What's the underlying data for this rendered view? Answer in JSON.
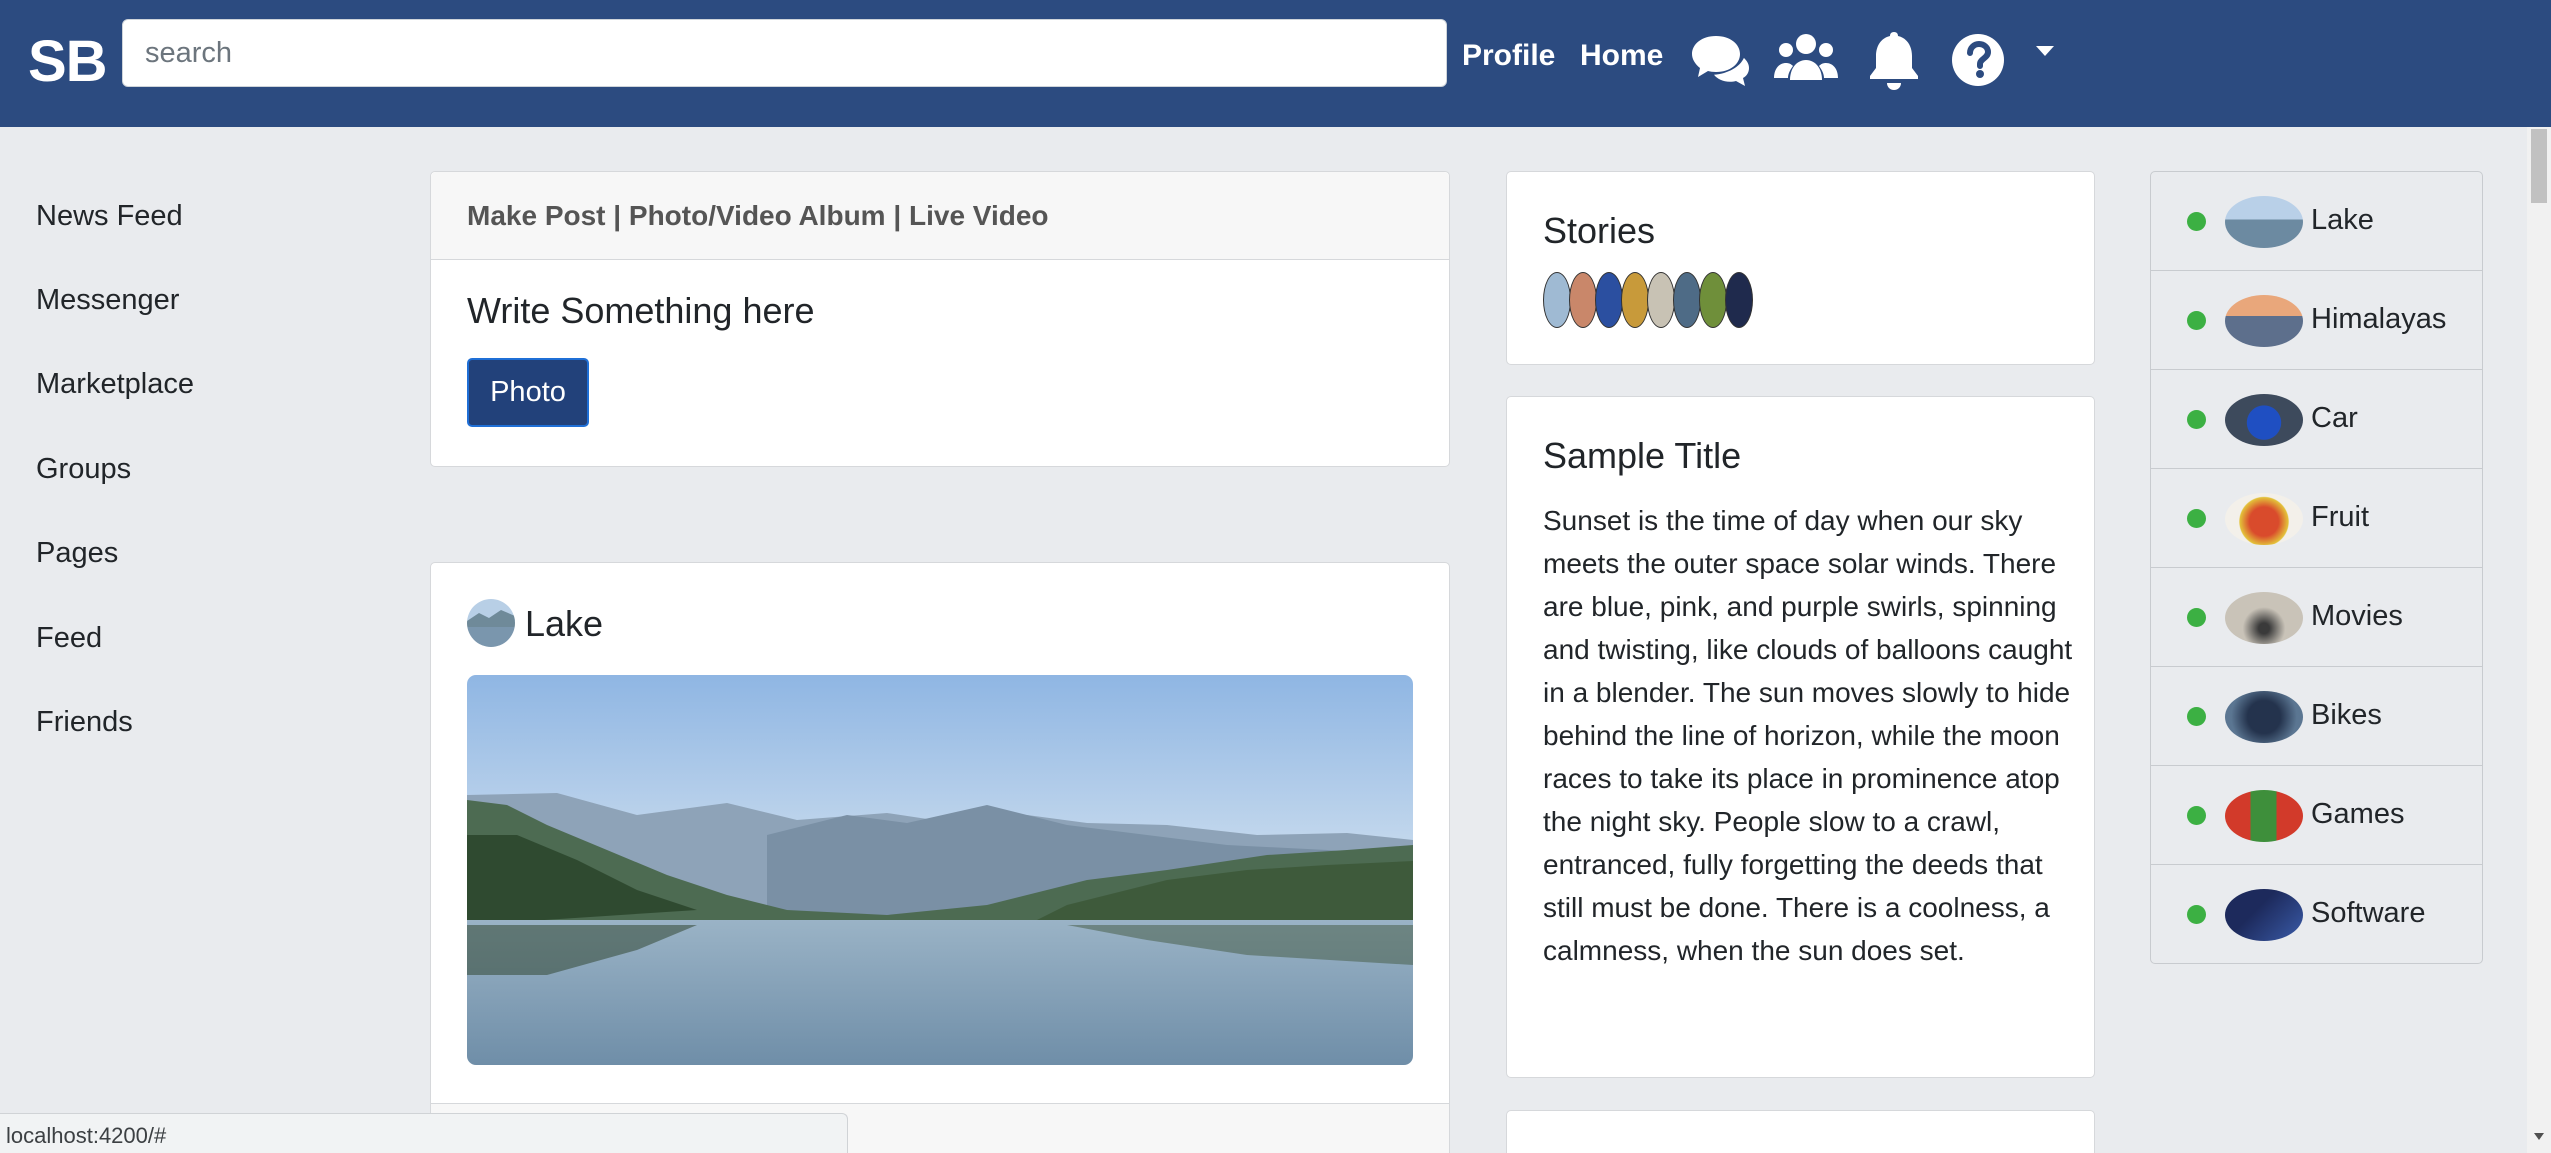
{
  "navbar": {
    "brand": "SB",
    "search_placeholder": "search",
    "links": {
      "profile": "Profile",
      "home": "Home"
    },
    "icons": [
      "chat-icon",
      "group-icon",
      "bell-icon",
      "help-icon",
      "caret-down-icon"
    ],
    "colors": {
      "background": "#2c4b80",
      "text": "#ffffff"
    }
  },
  "sidebar": {
    "items": [
      {
        "label": "News Feed"
      },
      {
        "label": "Messenger"
      },
      {
        "label": "Marketplace"
      },
      {
        "label": "Groups"
      },
      {
        "label": "Pages"
      },
      {
        "label": "Feed"
      },
      {
        "label": "Friends"
      }
    ]
  },
  "composer": {
    "links": [
      "Make Post",
      "Photo/Video Album",
      "Live Video"
    ],
    "separator": " | ",
    "title": "Write Something here",
    "photo_button": "Photo"
  },
  "post": {
    "author": "Lake",
    "image": "lake-landscape"
  },
  "stories": {
    "title": "Stories",
    "thumbnails": [
      "lake",
      "himalayas",
      "car",
      "fruit",
      "movies",
      "bikes",
      "games",
      "software"
    ]
  },
  "sample_card": {
    "title": "Sample Title",
    "text": "Sunset is the time of day when our sky meets the outer space solar winds. There are blue, pink, and purple swirls, spinning and twisting, like clouds of balloons caught in a blender. The sun moves slowly to hide behind the line of horizon, while the moon races to take its place in prominence atop the night sky. People slow to a crawl, entranced, fully forgetting the deeds that still must be done. There is a coolness, a calmness, when the sun does set."
  },
  "right_list": {
    "items": [
      {
        "label": "Lake",
        "status": "online"
      },
      {
        "label": "Himalayas",
        "status": "online"
      },
      {
        "label": "Car",
        "status": "online"
      },
      {
        "label": "Fruit",
        "status": "online"
      },
      {
        "label": "Movies",
        "status": "online"
      },
      {
        "label": "Bikes",
        "status": "online"
      },
      {
        "label": "Games",
        "status": "online"
      },
      {
        "label": "Software",
        "status": "online"
      }
    ],
    "online_color": "#3cb043"
  },
  "status_bar": {
    "url": "localhost:4200/#"
  }
}
